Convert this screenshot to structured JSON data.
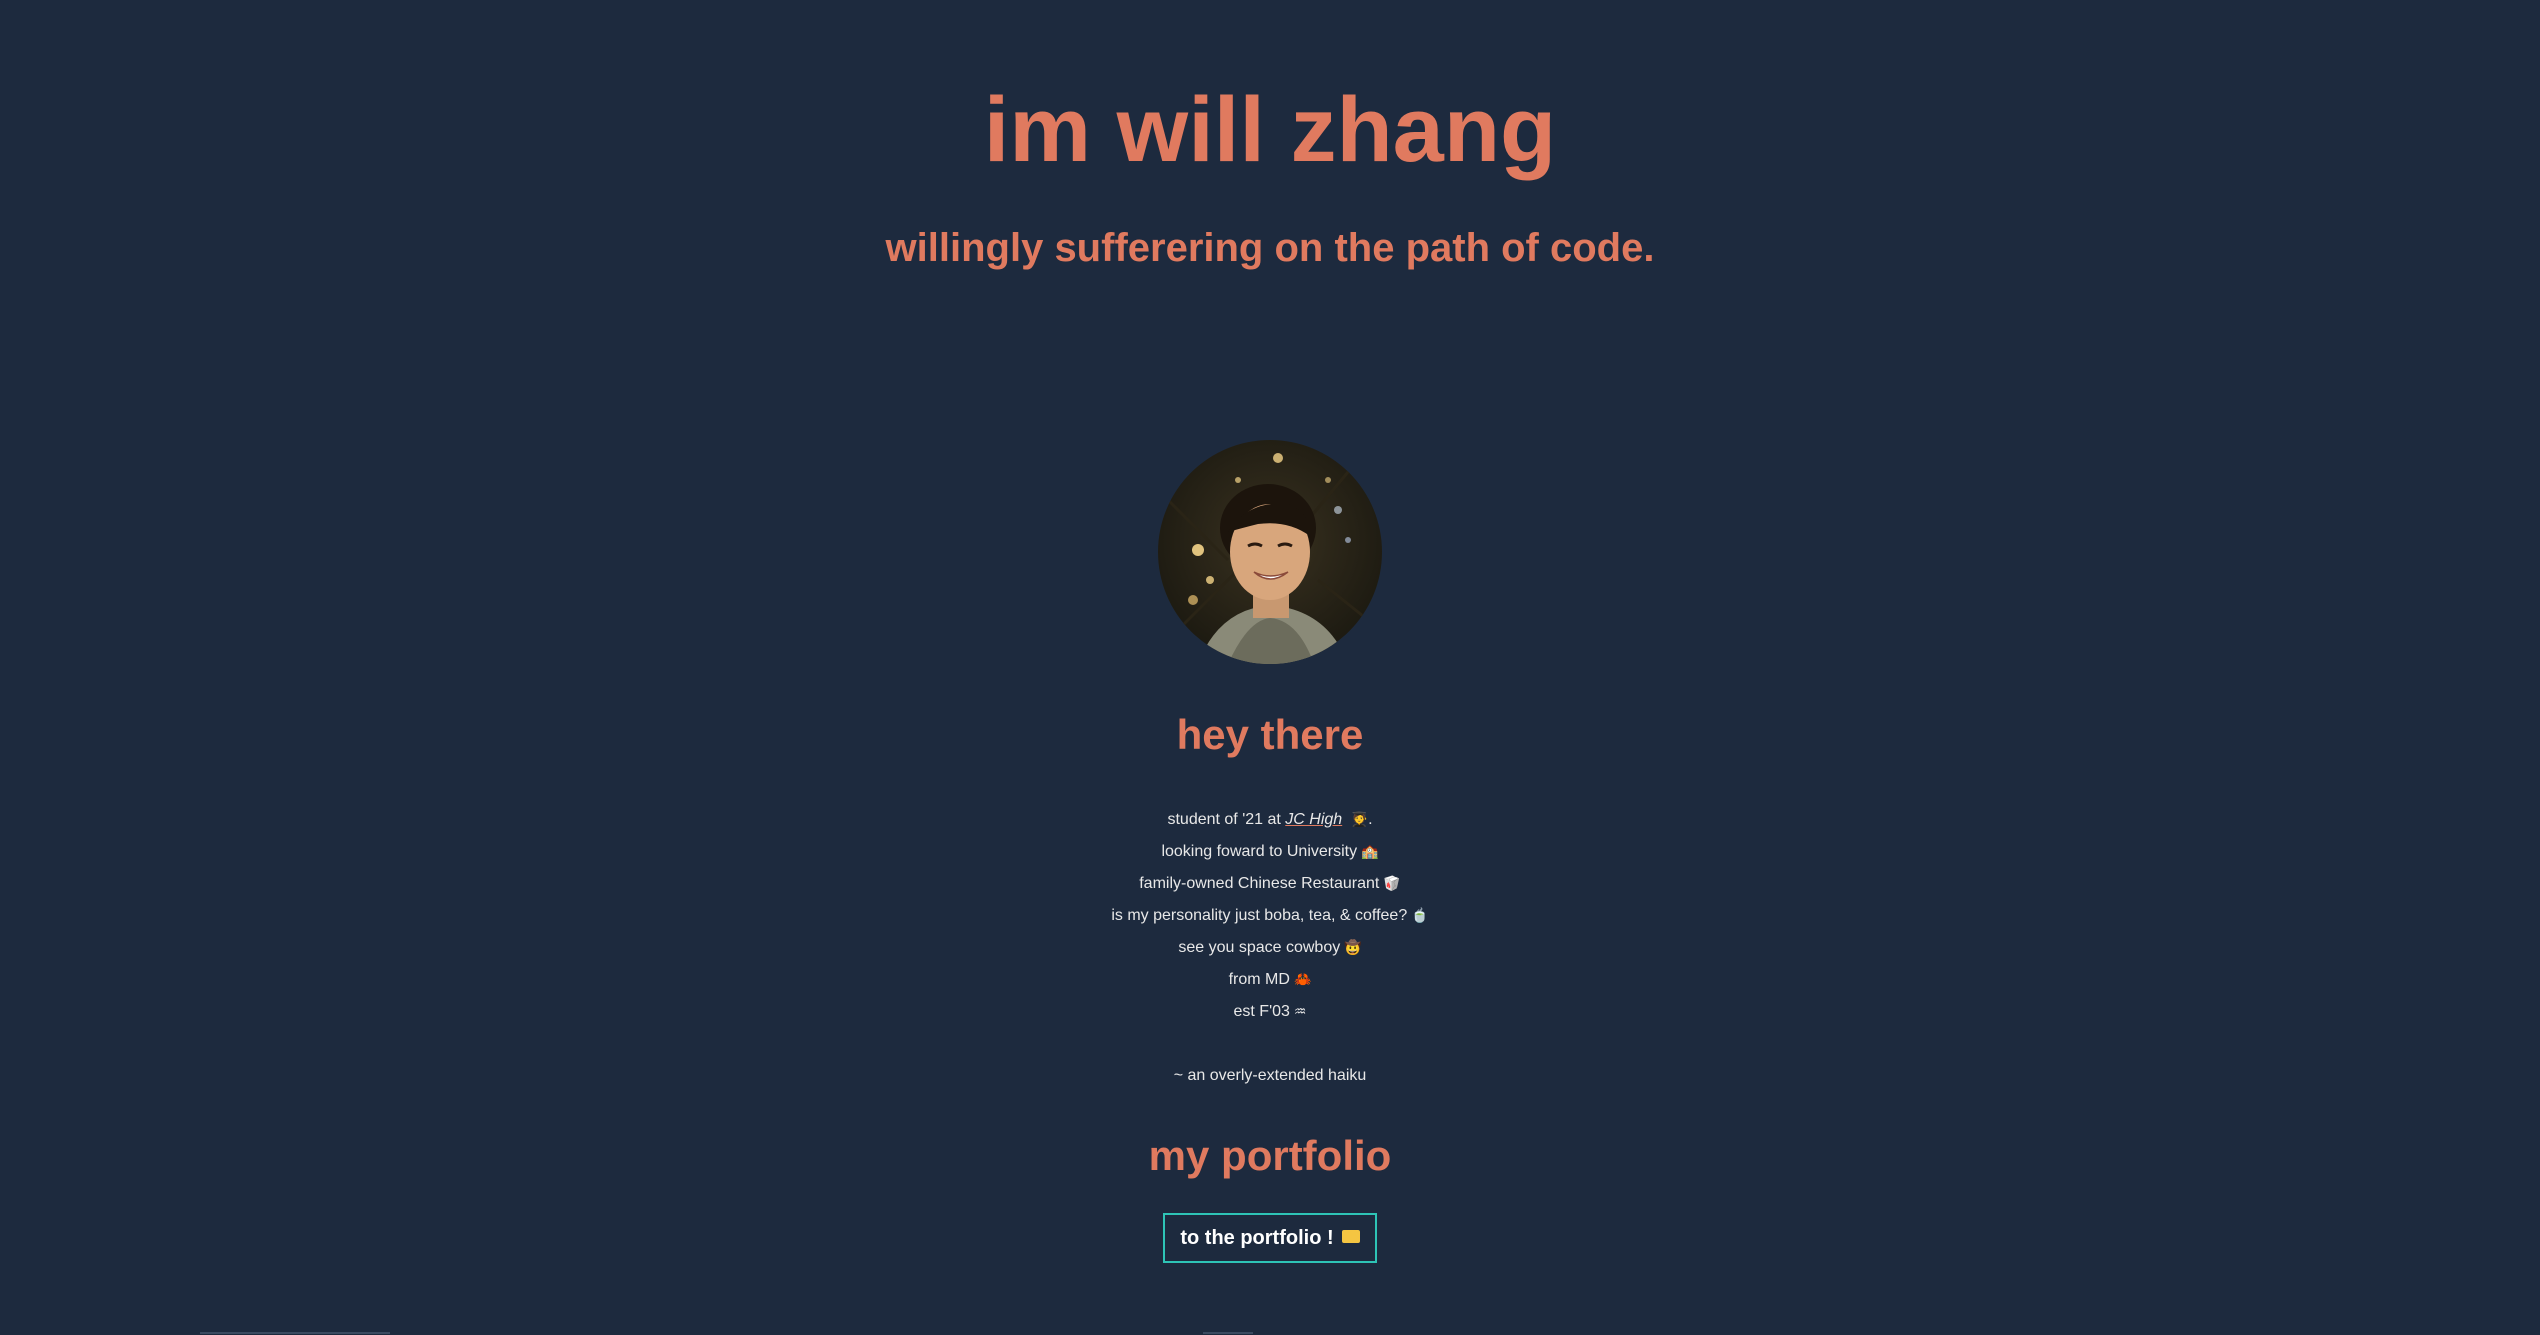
{
  "hero": {
    "title": "im will zhang",
    "subtitle": "willingly sufferering on the path of code."
  },
  "about": {
    "heading": "hey there",
    "lines": [
      {
        "pre": "student of '21 at ",
        "link": "JC High",
        "post": "",
        "emoji": "🧑‍🎓",
        "tail": "."
      },
      {
        "text": "looking foward to University",
        "emoji": "🏫"
      },
      {
        "text": "family-owned Chinese Restaurant",
        "emoji": "🥡"
      },
      {
        "text": "is my personality just boba, tea, & coffee?",
        "emoji": "🍵"
      },
      {
        "text": "see you space cowboy",
        "emoji": "🤠"
      },
      {
        "text": "from MD",
        "emoji": "🦀"
      },
      {
        "text": "est F'03",
        "emoji": "♒"
      }
    ],
    "haiku_note": "~ an overly-extended haiku"
  },
  "portfolio": {
    "heading": "my portfolio",
    "button_label": "to the portfolio !",
    "button_icon": "folder-icon"
  },
  "colors": {
    "background": "#1d2a3e",
    "accent": "#e07a5f",
    "button_border": "#2ec4b6",
    "text": "#e8e8e8"
  }
}
